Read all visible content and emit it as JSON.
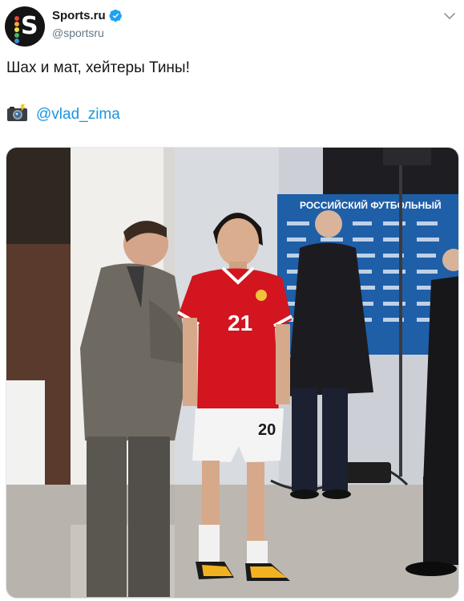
{
  "account": {
    "display_name": "Sports.ru",
    "handle": "@sportsru",
    "avatar_letter": "S",
    "verified": true
  },
  "tweet": {
    "text": "Шах и мат, хейтеры Тины!",
    "mention": "@vlad_zima",
    "camera_emoji": "camera-with-flash-icon"
  },
  "photo": {
    "banner_text": "РОССИЙСКИЙ ФУТБОЛЬНЫЙ",
    "shirt_number": "21",
    "shorts_number": "20"
  },
  "colors": {
    "link": "#1b95e0",
    "verified": "#1da1f2",
    "secondary_text": "#657786",
    "avatar_bg": "#141414"
  }
}
